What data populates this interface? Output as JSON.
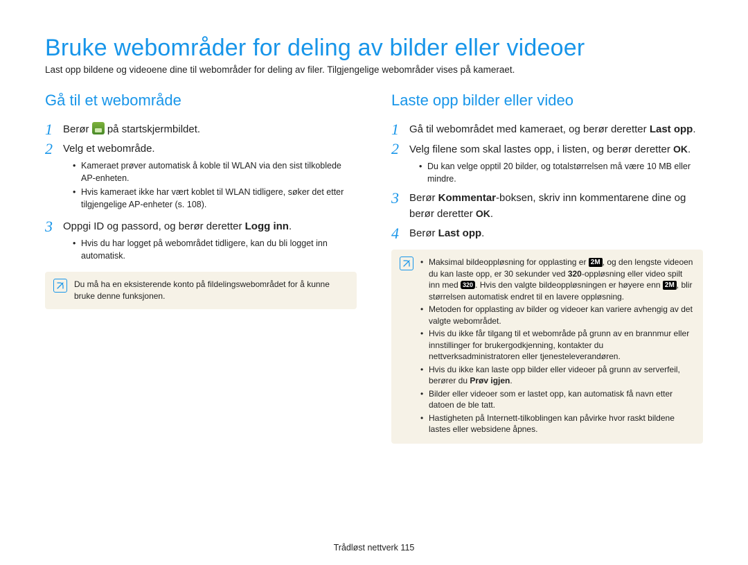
{
  "title": "Bruke webområder for deling av bilder eller videoer",
  "intro": "Last opp bildene og videoene dine til webområder for deling av filer. Tilgjengelige webområder vises på kameraet.",
  "left": {
    "heading": "Gå til et webområde",
    "step1_a": "Berør ",
    "step1_b": " på startskjermbildet.",
    "step2": "Velg et webområde.",
    "step2_sub1": "Kameraet prøver automatisk å koble til WLAN via den sist tilkoblede AP-enheten.",
    "step2_sub2": "Hvis kameraet ikke har vært koblet til WLAN tidligere, søker det etter tilgjengelige AP-enheter (s. 108).",
    "step3_a": "Oppgi ID og passord, og berør deretter ",
    "step3_b": "Logg inn",
    "step3_c": ".",
    "step3_sub1": "Hvis du har logget på webområdet tidligere, kan du bli logget inn automatisk.",
    "note": "Du må ha en eksisterende konto på fildelingswebområdet for å kunne bruke denne funksjonen."
  },
  "right": {
    "heading": "Laste opp bilder eller video",
    "step1_a": "Gå til webområdet med kameraet, og berør deretter ",
    "step1_b": "Last opp",
    "step1_c": ".",
    "step2_a": "Velg filene som skal lastes opp, i listen, og berør deretter ",
    "step2_b": ".",
    "step2_sub1": "Du kan velge opptil 20 bilder, og totalstørrelsen må være 10 MB eller mindre.",
    "step3_a": "Berør ",
    "step3_b": "Kommentar",
    "step3_c": "-boksen, skriv inn kommentarene dine og berør deretter ",
    "step3_d": ".",
    "step4_a": "Berør ",
    "step4_b": "Last opp",
    "step4_c": ".",
    "note1_a": "Maksimal bildeoppløsning for opplasting er ",
    "note1_b": ", og den lengste videoen du kan laste opp, er 30 sekunder ved ",
    "note1_c": "-oppløsning eller video spilt inn med ",
    "note1_d": ". Hvis den valgte bildeoppløsningen er høyere enn ",
    "note1_e": ", blir størrelsen automatisk endret til en lavere oppløsning.",
    "note2": "Metoden for opplasting av bilder og videoer kan variere avhengig av det valgte webområdet.",
    "note3": "Hvis du ikke får tilgang til et webområde på grunn av en brannmur eller innstillinger for brukergodkjenning, kontakter du nettverksadministratoren eller tjenesteleverandøren.",
    "note4_a": "Hvis du ikke kan laste opp bilder eller videoer på grunn av serverfeil, berører du ",
    "note4_b": "Prøv igjen",
    "note4_c": ".",
    "note5": "Bilder eller videoer som er lastet opp, kan automatisk få navn etter datoen de ble tatt.",
    "note6": "Hastigheten på Internett-tilkoblingen kan påvirke hvor raskt bildene lastes eller websidene åpnes."
  },
  "icons": {
    "ok": "OK",
    "tag2m": "2M",
    "tag320": "320",
    "tag320b": "320"
  },
  "footer_a": "Trådløst nettverk  ",
  "footer_b": "115"
}
